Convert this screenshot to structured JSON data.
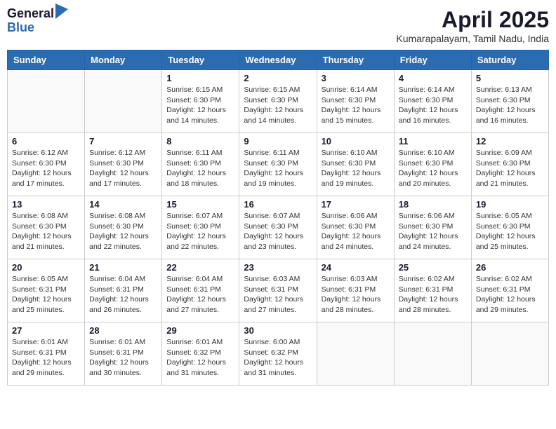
{
  "header": {
    "logo_general": "General",
    "logo_blue": "Blue",
    "title": "April 2025",
    "location": "Kumarapalayam, Tamil Nadu, India"
  },
  "days_of_week": [
    "Sunday",
    "Monday",
    "Tuesday",
    "Wednesday",
    "Thursday",
    "Friday",
    "Saturday"
  ],
  "weeks": [
    [
      {
        "day": "",
        "detail": ""
      },
      {
        "day": "",
        "detail": ""
      },
      {
        "day": "1",
        "detail": "Sunrise: 6:15 AM\nSunset: 6:30 PM\nDaylight: 12 hours\nand 14 minutes."
      },
      {
        "day": "2",
        "detail": "Sunrise: 6:15 AM\nSunset: 6:30 PM\nDaylight: 12 hours\nand 14 minutes."
      },
      {
        "day": "3",
        "detail": "Sunrise: 6:14 AM\nSunset: 6:30 PM\nDaylight: 12 hours\nand 15 minutes."
      },
      {
        "day": "4",
        "detail": "Sunrise: 6:14 AM\nSunset: 6:30 PM\nDaylight: 12 hours\nand 16 minutes."
      },
      {
        "day": "5",
        "detail": "Sunrise: 6:13 AM\nSunset: 6:30 PM\nDaylight: 12 hours\nand 16 minutes."
      }
    ],
    [
      {
        "day": "6",
        "detail": "Sunrise: 6:12 AM\nSunset: 6:30 PM\nDaylight: 12 hours\nand 17 minutes."
      },
      {
        "day": "7",
        "detail": "Sunrise: 6:12 AM\nSunset: 6:30 PM\nDaylight: 12 hours\nand 17 minutes."
      },
      {
        "day": "8",
        "detail": "Sunrise: 6:11 AM\nSunset: 6:30 PM\nDaylight: 12 hours\nand 18 minutes."
      },
      {
        "day": "9",
        "detail": "Sunrise: 6:11 AM\nSunset: 6:30 PM\nDaylight: 12 hours\nand 19 minutes."
      },
      {
        "day": "10",
        "detail": "Sunrise: 6:10 AM\nSunset: 6:30 PM\nDaylight: 12 hours\nand 19 minutes."
      },
      {
        "day": "11",
        "detail": "Sunrise: 6:10 AM\nSunset: 6:30 PM\nDaylight: 12 hours\nand 20 minutes."
      },
      {
        "day": "12",
        "detail": "Sunrise: 6:09 AM\nSunset: 6:30 PM\nDaylight: 12 hours\nand 21 minutes."
      }
    ],
    [
      {
        "day": "13",
        "detail": "Sunrise: 6:08 AM\nSunset: 6:30 PM\nDaylight: 12 hours\nand 21 minutes."
      },
      {
        "day": "14",
        "detail": "Sunrise: 6:08 AM\nSunset: 6:30 PM\nDaylight: 12 hours\nand 22 minutes."
      },
      {
        "day": "15",
        "detail": "Sunrise: 6:07 AM\nSunset: 6:30 PM\nDaylight: 12 hours\nand 22 minutes."
      },
      {
        "day": "16",
        "detail": "Sunrise: 6:07 AM\nSunset: 6:30 PM\nDaylight: 12 hours\nand 23 minutes."
      },
      {
        "day": "17",
        "detail": "Sunrise: 6:06 AM\nSunset: 6:30 PM\nDaylight: 12 hours\nand 24 minutes."
      },
      {
        "day": "18",
        "detail": "Sunrise: 6:06 AM\nSunset: 6:30 PM\nDaylight: 12 hours\nand 24 minutes."
      },
      {
        "day": "19",
        "detail": "Sunrise: 6:05 AM\nSunset: 6:30 PM\nDaylight: 12 hours\nand 25 minutes."
      }
    ],
    [
      {
        "day": "20",
        "detail": "Sunrise: 6:05 AM\nSunset: 6:31 PM\nDaylight: 12 hours\nand 25 minutes."
      },
      {
        "day": "21",
        "detail": "Sunrise: 6:04 AM\nSunset: 6:31 PM\nDaylight: 12 hours\nand 26 minutes."
      },
      {
        "day": "22",
        "detail": "Sunrise: 6:04 AM\nSunset: 6:31 PM\nDaylight: 12 hours\nand 27 minutes."
      },
      {
        "day": "23",
        "detail": "Sunrise: 6:03 AM\nSunset: 6:31 PM\nDaylight: 12 hours\nand 27 minutes."
      },
      {
        "day": "24",
        "detail": "Sunrise: 6:03 AM\nSunset: 6:31 PM\nDaylight: 12 hours\nand 28 minutes."
      },
      {
        "day": "25",
        "detail": "Sunrise: 6:02 AM\nSunset: 6:31 PM\nDaylight: 12 hours\nand 28 minutes."
      },
      {
        "day": "26",
        "detail": "Sunrise: 6:02 AM\nSunset: 6:31 PM\nDaylight: 12 hours\nand 29 minutes."
      }
    ],
    [
      {
        "day": "27",
        "detail": "Sunrise: 6:01 AM\nSunset: 6:31 PM\nDaylight: 12 hours\nand 29 minutes."
      },
      {
        "day": "28",
        "detail": "Sunrise: 6:01 AM\nSunset: 6:31 PM\nDaylight: 12 hours\nand 30 minutes."
      },
      {
        "day": "29",
        "detail": "Sunrise: 6:01 AM\nSunset: 6:32 PM\nDaylight: 12 hours\nand 31 minutes."
      },
      {
        "day": "30",
        "detail": "Sunrise: 6:00 AM\nSunset: 6:32 PM\nDaylight: 12 hours\nand 31 minutes."
      },
      {
        "day": "",
        "detail": ""
      },
      {
        "day": "",
        "detail": ""
      },
      {
        "day": "",
        "detail": ""
      }
    ]
  ]
}
